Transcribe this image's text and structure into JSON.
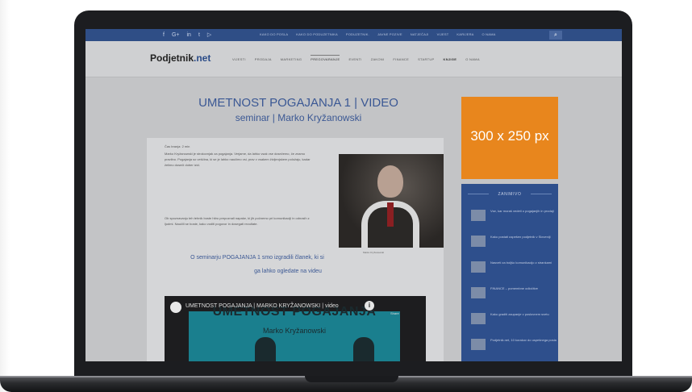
{
  "topbar": {
    "social": [
      "f",
      "G+",
      "in",
      "t",
      "▷"
    ],
    "links": [
      "KAKO DO POSLA",
      "KAKO DO PODUZETNIKA",
      "PODUZETNIK.",
      "JAVNE POZIVE",
      "NATJEČAJI",
      "VIJEST",
      "KARIJERA",
      "O NAMA"
    ],
    "search_icon": "search-icon"
  },
  "header": {
    "logo_main": "Podjetnik",
    "logo_dot": ".net",
    "nav": [
      "VIJESTI",
      "PRODAJA",
      "MARKETING",
      "PREGOVARANJE",
      "EVENTI",
      "ZAKONI",
      "FINANCE",
      "STARTUP",
      "KNJIGE",
      "O NAMA"
    ]
  },
  "article": {
    "title_line1": "UMETNOST POGAJANJA 1 | VIDEO",
    "title_line2": "seminar | Marko Kryžanowski",
    "read_time": "Čas branja: 2 min",
    "para1": "Marko Kryžanowski je strokovnjak za pogajanja. Verjame, da lahko vsak vse dosežemo, če znamo pravilno. Pogajanja so veščina, ki se je lahko naučimo vsi, prav v vsakem življenjskem položaju, kadar želimo doseči dober izid.",
    "para2": "Ob spoznavanju teh tehnik boste hitro prepoznali napake, ki jih počnemo pri komunikaciji in odnosih z ljudmi. Naučili se boste, kako voditi pogovor in dosegati rezultate.",
    "caption": "Marko Kryžanowski",
    "quote_line1": "O seminarju POGAJANJA 1 smo izgradili članek, ki si",
    "quote_line2": "ga lahko ogledate na videu"
  },
  "video": {
    "channel_title": "UMETNOST POGAJANJA | MARKO KRYŽANOWSKI | video",
    "share_label": "Share",
    "thumb_title": "UMETNOST POGAJANJA",
    "thumb_sub": "Marko Kryžanowski"
  },
  "sidebar": {
    "ad_label": "300 x 250 px",
    "widget_title": "ZANIMIVO",
    "items": [
      "Vse, kar moraš vedeti o pogajanjih in prodaji",
      "Kako postati uspešen podjetnik v Sloveniji",
      "Nasveti za boljšo komunikacijo z strankami",
      "FINANCE – pomembne odločitve",
      "Kako graditi zaupanje v poslovnem svetu",
      "Podjetnik.net, 10 korakov do uspešnega posla"
    ]
  }
}
